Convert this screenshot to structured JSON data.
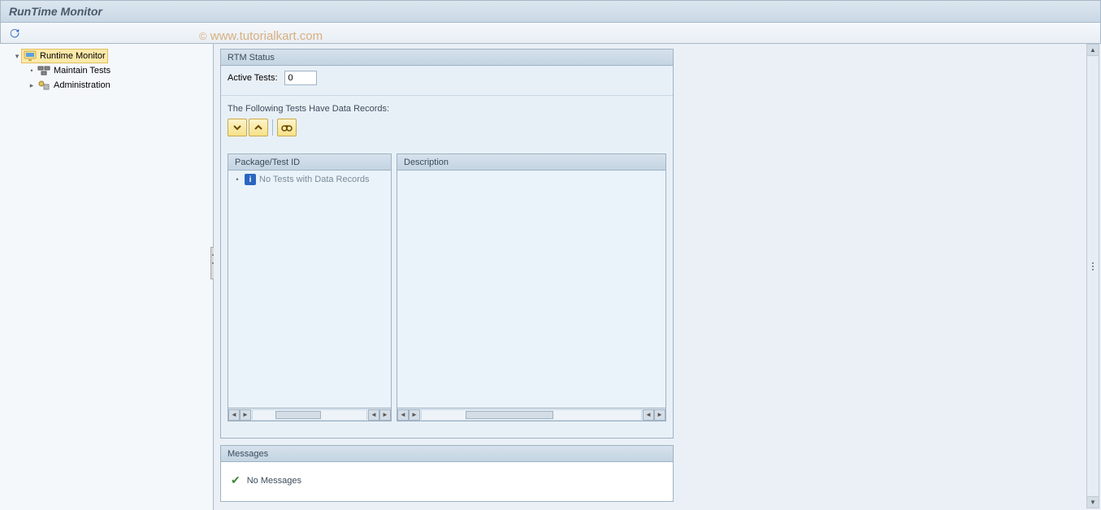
{
  "title": "RunTime Monitor",
  "watermark": "© www.tutorialkart.com",
  "tree": {
    "root": {
      "label": "Runtime Monitor"
    },
    "children": [
      {
        "label": "Maintain Tests"
      },
      {
        "label": "Administration"
      }
    ]
  },
  "rtm": {
    "panel_title": "RTM Status",
    "active_label": "Active Tests:",
    "active_value": "0",
    "following_label": "The Following Tests Have Data Records:",
    "columns": {
      "package": "Package/Test ID",
      "description": "Description"
    },
    "empty_row": "No Tests with Data Records"
  },
  "messages": {
    "title": "Messages",
    "none": "No Messages"
  }
}
